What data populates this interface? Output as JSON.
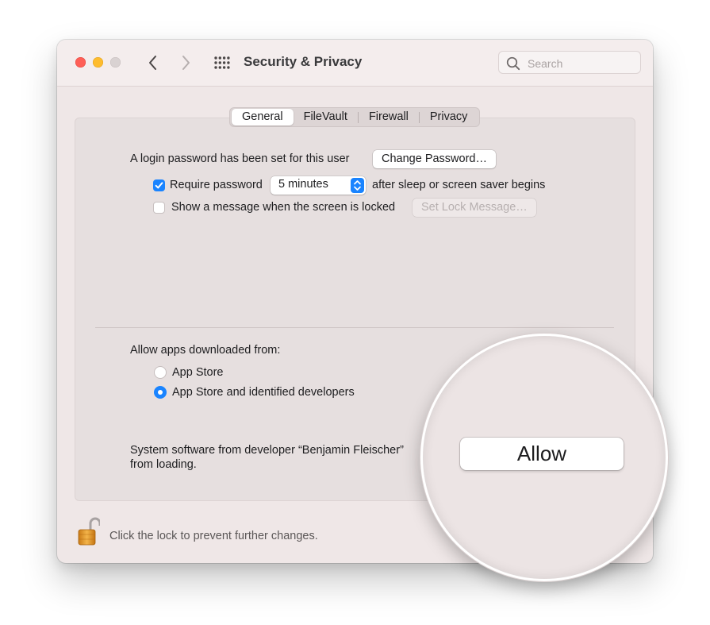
{
  "window": {
    "title": "Security & Privacy"
  },
  "search": {
    "placeholder": "Search"
  },
  "tabs": [
    {
      "label": "General",
      "active": true
    },
    {
      "label": "FileVault",
      "active": false
    },
    {
      "label": "Firewall",
      "active": false
    },
    {
      "label": "Privacy",
      "active": false
    }
  ],
  "general": {
    "login_text": "A login password has been set for this user",
    "change_password_button": "Change Password…",
    "require_password": {
      "label": "Require password",
      "checked": true
    },
    "require_delay": {
      "selected": "5 minutes"
    },
    "after_sleep_text": "after sleep or screen saver begins",
    "show_message": {
      "label": "Show a message when the screen is locked",
      "checked": false
    },
    "set_lock_message_button": "Set Lock Message…"
  },
  "downloads": {
    "heading": "Allow apps downloaded from:",
    "options": [
      {
        "label": "App Store",
        "selected": false
      },
      {
        "label": "App Store and identified developers",
        "selected": true
      }
    ]
  },
  "system_software": {
    "line1": "System software from developer “Benjamin Fleischer”",
    "line2": "from loading."
  },
  "allow_button": "Allow",
  "lock": {
    "text": "Click the lock to prevent further changes."
  },
  "colors": {
    "accent": "#1a84ff",
    "close": "#fe5f57",
    "minimize": "#febc2e"
  }
}
